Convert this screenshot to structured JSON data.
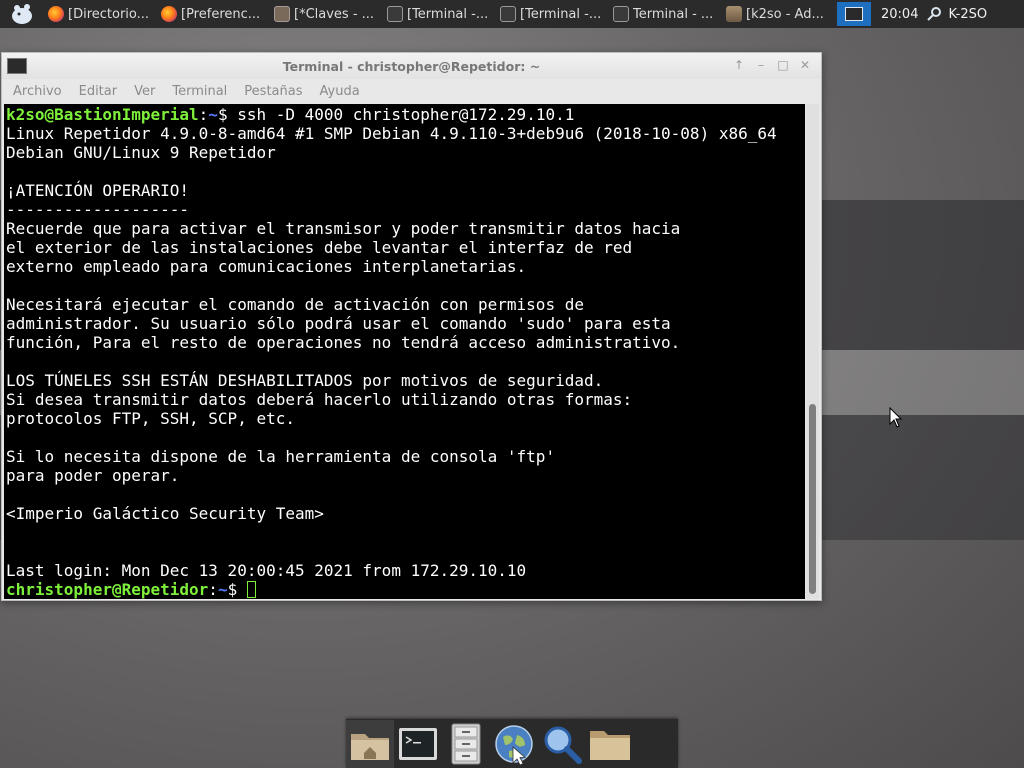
{
  "panel": {
    "tasks": [
      {
        "label": "[Directorio...",
        "icon": "firefox-icon"
      },
      {
        "label": "[Preferenc...",
        "icon": "firefox-icon"
      },
      {
        "label": "[*Claves - ...",
        "icon": "keepass-icon"
      },
      {
        "label": "[Terminal -...",
        "icon": "terminal-icon"
      },
      {
        "label": "[Terminal -...",
        "icon": "terminal-icon"
      },
      {
        "label": "Terminal - ...",
        "icon": "terminal-icon"
      },
      {
        "label": "[k2so - Ad...",
        "icon": "home-folder-icon"
      }
    ],
    "clock": "20:04",
    "username": "K-2SO"
  },
  "window": {
    "title": "Terminal - christopher@Repetidor: ~",
    "menu": [
      "Archivo",
      "Editar",
      "Ver",
      "Terminal",
      "Pestañas",
      "Ayuda"
    ]
  },
  "terminal": {
    "first_prompt_user": "k2so@BastionImperial",
    "first_prompt_path": "~",
    "first_command": "$ ssh -D 4000 christopher@172.29.10.1",
    "body": "Linux Repetidor 4.9.0-8-amd64 #1 SMP Debian 4.9.110-3+deb9u6 (2018-10-08) x86_64\nDebian GNU/Linux 9 Repetidor\n\n¡ATENCIÓN OPERARIO!\n-------------------\nRecuerde que para activar el transmisor y poder transmitir datos hacia\nel exterior de las instalaciones debe levantar el interfaz de red\nexterno empleado para comunicaciones interplanetarias.\n\nNecesitará ejecutar el comando de activación con permisos de\nadministrador. Su usuario sólo podrá usar el comando 'sudo' para esta\nfunción, Para el resto de operaciones no tendrá acceso administrativo.\n\nLOS TÚNELES SSH ESTÁN DESHABILITADOS por motivos de seguridad.\nSi desea transmitir datos deberá hacerlo utilizando otras formas:\nprotocolos FTP, SSH, SCP, etc.\n\nSi lo necesita dispone de la herramienta de consola 'ftp'\npara poder operar.\n\n<Imperio Galáctico Security Team>\n\n\nLast login: Mon Dec 13 20:00:45 2021 from 172.29.10.10",
    "last_prompt_user": "christopher@Repetidor",
    "last_prompt_path": "~",
    "last_prompt_symbol": "$ "
  },
  "dock": {
    "items": [
      {
        "icon": "home-folder-icon"
      },
      {
        "icon": "terminal-icon"
      },
      {
        "icon": "file-cabinet-icon"
      },
      {
        "icon": "web-browser-icon"
      },
      {
        "icon": "search-icon"
      },
      {
        "icon": "folder-icon"
      }
    ]
  },
  "colors": {
    "prompt_user": "#7ef03a",
    "prompt_path": "#5a7bff",
    "panel_bg": "#2b2b2b",
    "active_tray": "#1e6fbf"
  }
}
